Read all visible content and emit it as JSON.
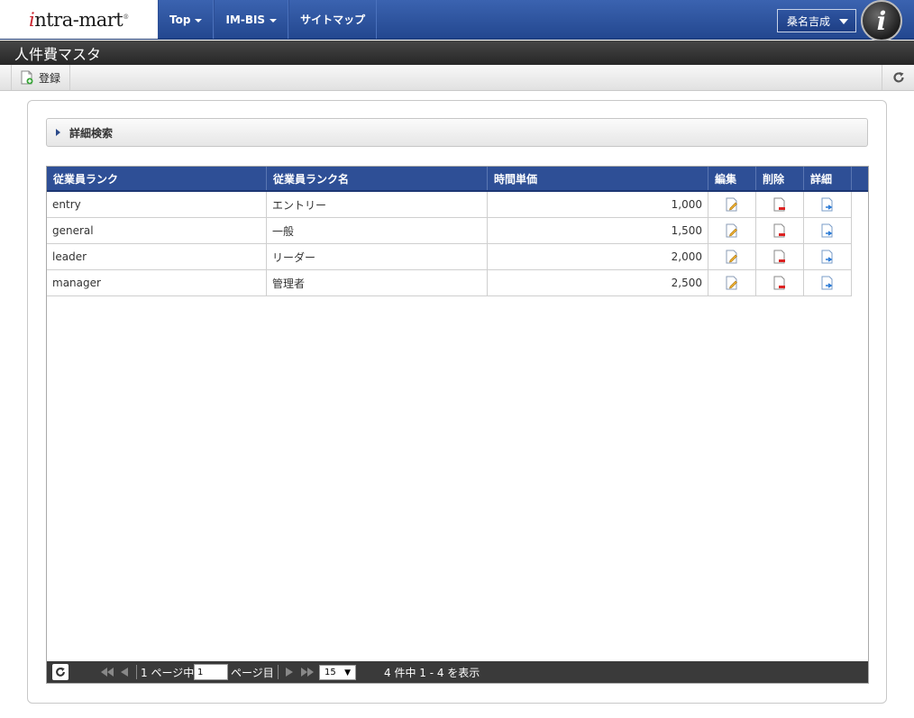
{
  "header": {
    "logo_prefix": "i",
    "logo_rest": "ntra-mart",
    "logo_mark": "®",
    "nav": [
      "Top",
      "IM-BIS",
      "サイトマップ"
    ],
    "user_name": "桑名吉成",
    "avatar_letter": "i"
  },
  "page": {
    "title": "人件費マスタ",
    "register_label": "登録"
  },
  "search": {
    "label": "詳細検索"
  },
  "table": {
    "columns": [
      "従業員ランク",
      "従業員ランク名",
      "時間単価",
      "編集",
      "削除",
      "詳細"
    ],
    "rows": [
      {
        "rank": "entry",
        "name": "エントリー",
        "rate": "1,000"
      },
      {
        "rank": "general",
        "name": "一般",
        "rate": "1,500"
      },
      {
        "rank": "leader",
        "name": "リーダー",
        "rate": "2,000"
      },
      {
        "rank": "manager",
        "name": "管理者",
        "rate": "2,500"
      }
    ]
  },
  "pager": {
    "total_pages_text": "1 ページ中",
    "current_page": "1",
    "page_suffix": "ページ目",
    "rows_per_page": "15",
    "summary": "4 件中 1 - 4 を表示"
  },
  "colors": {
    "nav_blue": "#2e4f96",
    "title_bar": "#2f2f2f",
    "pager_bar": "#3a3a3a"
  }
}
